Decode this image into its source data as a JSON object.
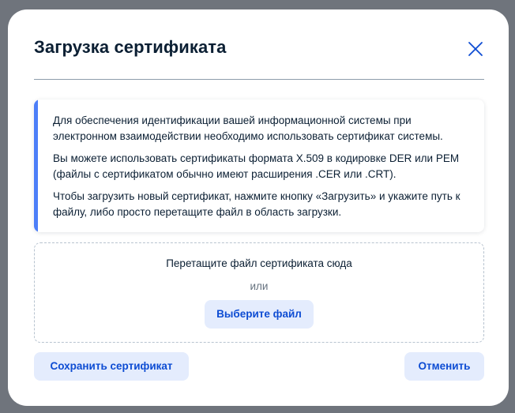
{
  "modal": {
    "title": "Загрузка сертификата",
    "close_icon": "close-icon"
  },
  "info": {
    "paragraphs": [
      "Для обеспечения идентификации вашей информационной системы при электронном взаимодействии необходимо использовать сертификат системы.",
      "Вы можете использовать сертификаты формата X.509 в кодировке DER или PEM (файлы с сертификатом обычно имеют расширения .CER или .CRT).",
      "Чтобы загрузить новый сертификат, нажмите кнопку «Загрузить» и укажите путь к файлу, либо просто перетащите файл в область загрузки."
    ]
  },
  "dropzone": {
    "hint": "Перетащите файл сертификата сюда",
    "or": "или",
    "choose_label": "Выберите файл"
  },
  "footer": {
    "save_label": "Сохранить сертификат",
    "cancel_label": "Отменить"
  },
  "colors": {
    "accent": "#4c7ef8",
    "primary_text": "#0b1f33",
    "button_bg": "#e4ecfd",
    "button_text": "#0d4cd3"
  }
}
